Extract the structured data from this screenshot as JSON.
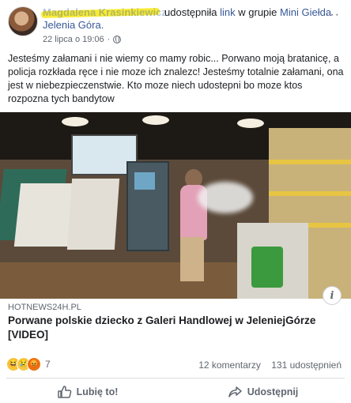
{
  "post": {
    "author_name": "Magdalena Krasinkiewicz",
    "header_action": "udostępniła",
    "header_link": "link",
    "header_in_group": "w grupie",
    "group_name_part1": "Mini Giełda",
    "group_name_part2": "Jelenia Góra.",
    "timestamp": "22 lipca o 19:06",
    "more_label": "···",
    "text": "Jesteśmy załamani i nie wiemy co mamy robic... Porwano moją bratanicę, a policja rozkłada ręce i nie moze ich znalezc! Jesteśmy totalnie załamani, ona jest w niebezpieczenstwie. Kto moze niech udostepni bo moze ktos rozpozna tych bandytow"
  },
  "link_preview": {
    "source": "HOTNEWS24H.PL",
    "title": "Porwane polskie dziecko z Galeri Handlowej w JeleniejGórze [VIDEO]",
    "info_icon": "i"
  },
  "stats": {
    "reactions": [
      "haha-icon",
      "sad-icon",
      "angry-icon"
    ],
    "reaction_count": "7",
    "comments": "12 komentarzy",
    "shares": "131 udostępnień"
  },
  "actions": {
    "like_label": "Lubię to!",
    "share_label": "Udostępnij"
  }
}
